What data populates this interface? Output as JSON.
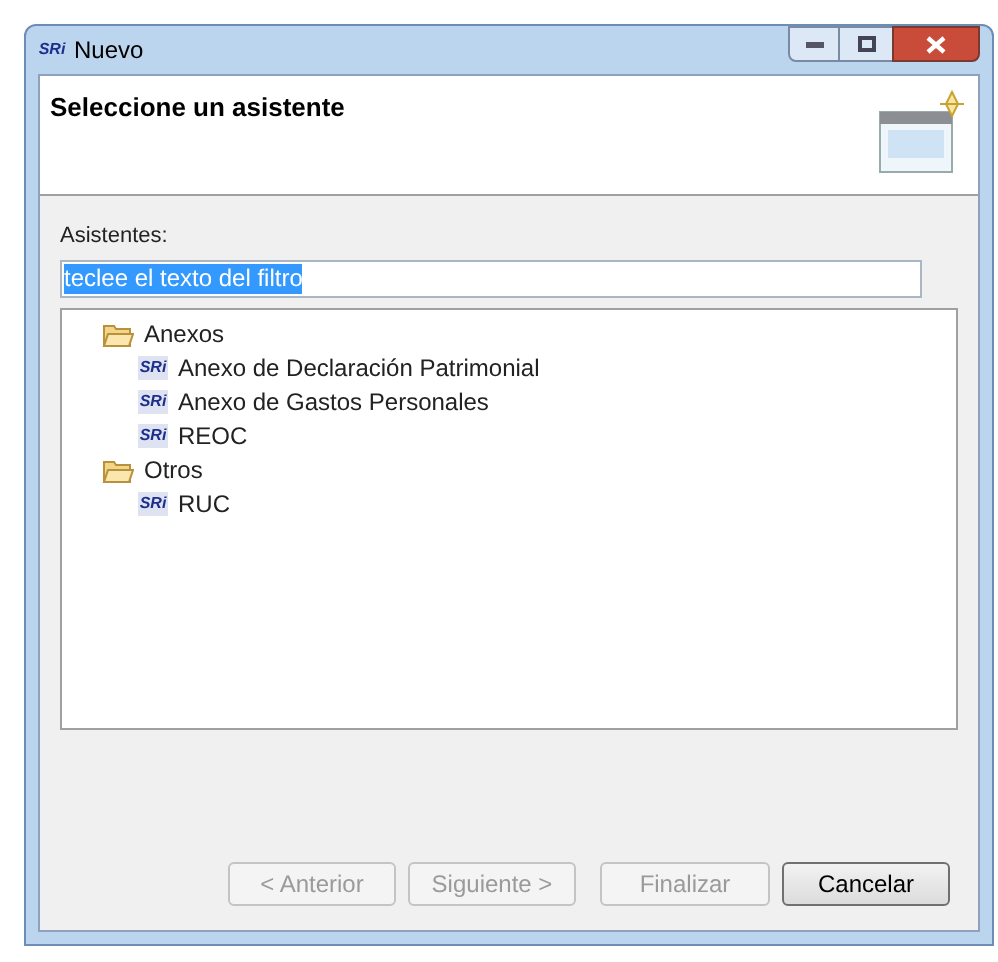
{
  "window": {
    "title": "Nuevo",
    "logo_text": "SRi"
  },
  "header": {
    "title": "Seleccione un asistente"
  },
  "filter": {
    "label": "Asistentes:",
    "value": "teclee el texto del filtro",
    "selected": true
  },
  "tree": [
    {
      "label": "Anexos",
      "kind": "folder",
      "expanded": true,
      "children": [
        {
          "label": "Anexo de Declaración Patrimonial",
          "kind": "item",
          "icon_text": "SRi"
        },
        {
          "label": "Anexo de Gastos Personales",
          "kind": "item",
          "icon_text": "SRi"
        },
        {
          "label": "REOC",
          "kind": "item",
          "icon_text": "SRi"
        }
      ]
    },
    {
      "label": "Otros",
      "kind": "folder",
      "expanded": true,
      "children": [
        {
          "label": "RUC",
          "kind": "item",
          "icon_text": "SRi"
        }
      ]
    }
  ],
  "buttons": [
    {
      "label": "< Anterior",
      "disabled": true
    },
    {
      "label": "Siguiente >",
      "disabled": true
    },
    {
      "label": "Finalizar",
      "disabled": true
    },
    {
      "label": "Cancelar",
      "disabled": false
    }
  ]
}
